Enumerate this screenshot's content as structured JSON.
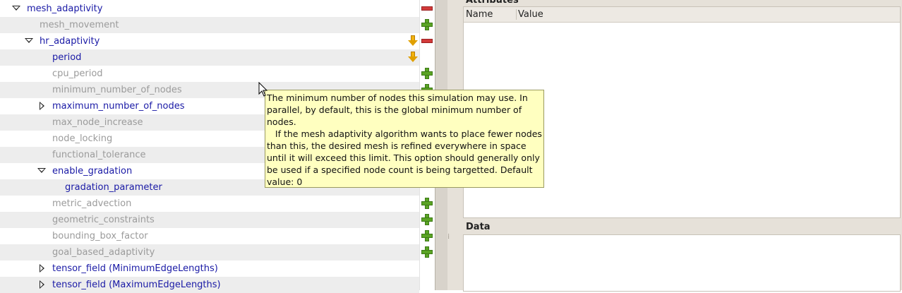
{
  "tree": {
    "rows": [
      {
        "label": "mesh_adaptivity",
        "state": "active",
        "expander": "down",
        "icons": [
          "minus-icon"
        ]
      },
      {
        "label": "mesh_movement",
        "state": "inactive",
        "expander": "",
        "icons": [
          "plus-icon"
        ]
      },
      {
        "label": "hr_adaptivity",
        "state": "active",
        "expander": "down",
        "icons": [
          "arrow-down-icon",
          "minus-icon"
        ]
      },
      {
        "label": "period",
        "state": "active",
        "expander": "",
        "icons": [
          "arrow-down-icon"
        ]
      },
      {
        "label": "cpu_period",
        "state": "inactive",
        "expander": "",
        "icons": [
          "plus-icon"
        ]
      },
      {
        "label": "minimum_number_of_nodes",
        "state": "inactive",
        "expander": "",
        "icons": [
          "plus-icon"
        ]
      },
      {
        "label": "maximum_number_of_nodes",
        "state": "active",
        "expander": "right",
        "icons": []
      },
      {
        "label": "max_node_increase",
        "state": "inactive",
        "expander": "",
        "icons": []
      },
      {
        "label": "node_locking",
        "state": "inactive",
        "expander": "",
        "icons": []
      },
      {
        "label": "functional_tolerance",
        "state": "inactive",
        "expander": "",
        "icons": []
      },
      {
        "label": "enable_gradation",
        "state": "active",
        "expander": "down",
        "icons": []
      },
      {
        "label": "gradation_parameter",
        "state": "active",
        "expander": "",
        "icons": []
      },
      {
        "label": "metric_advection",
        "state": "inactive",
        "expander": "",
        "icons": [
          "plus-icon"
        ]
      },
      {
        "label": "geometric_constraints",
        "state": "inactive",
        "expander": "",
        "icons": [
          "plus-icon"
        ]
      },
      {
        "label": "bounding_box_factor",
        "state": "inactive",
        "expander": "",
        "icons": [
          "plus-icon"
        ]
      },
      {
        "label": "goal_based_adaptivity",
        "state": "inactive",
        "expander": "",
        "icons": [
          "plus-icon"
        ]
      },
      {
        "label": "tensor_field (MinimumEdgeLengths)",
        "state": "active",
        "expander": "right",
        "icons": []
      },
      {
        "label": "tensor_field (MaximumEdgeLengths)",
        "state": "active",
        "expander": "right",
        "icons": []
      }
    ]
  },
  "tooltip": {
    "text": "The minimum number of nodes this simulation may use. In parallel, by default, this is the global minimum number of nodes.\n   If the mesh adaptivity algorithm wants to place fewer nodes than this, the desired mesh is refined everywhere in space until it will exceed this limit. This option should generally only be used if a specified node count is being targetted. Default value: 0"
  },
  "attributes": {
    "title": "Attributes",
    "col_name": "Name",
    "col_value": "Value"
  },
  "data_panel": {
    "title": "Data"
  },
  "colors": {
    "active_text": "#1a1aa6",
    "inactive_text": "#9b9b9b",
    "plus": "#5aa424",
    "minus": "#d23a3a",
    "arrow": "#f2b20d",
    "tooltip_bg": "#ffffc0"
  }
}
